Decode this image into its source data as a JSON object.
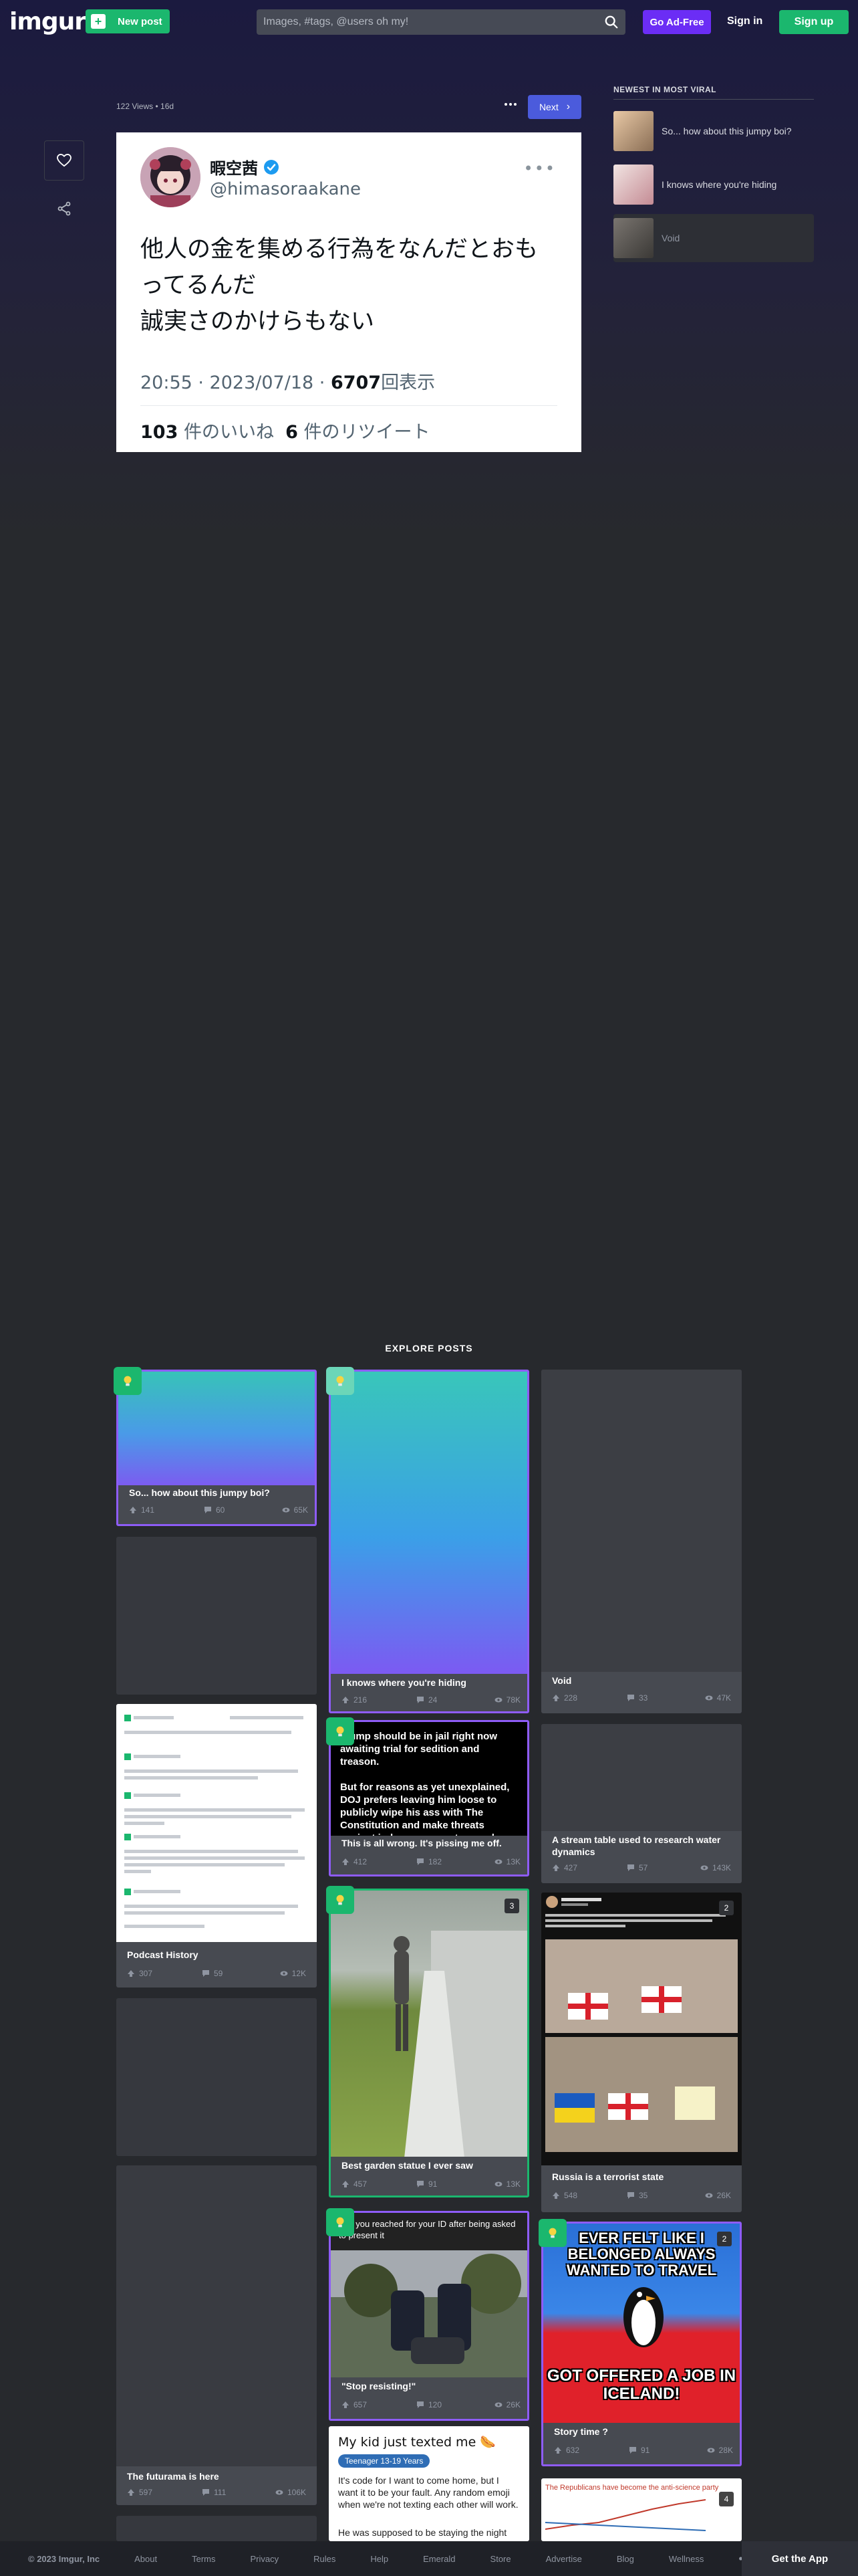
{
  "header": {
    "logo": "imgur",
    "new_post_label": "New post",
    "search_placeholder": "Images, #tags, @users oh my!",
    "adfree_label": "Go Ad-Free",
    "signin_label": "Sign in",
    "signup_label": "Sign up"
  },
  "post": {
    "meta": "122 Views • 16d",
    "next_label": "Next",
    "tweet": {
      "name": "暇空茜",
      "handle": "@himasoraakane",
      "lines": [
        "他人の金を集める行為をなんだとおも",
        "ってるんだ",
        "誠実さのかけらもない"
      ],
      "time": "20:55 · 2023/07/18 · ",
      "views_count": "6707",
      "views_label": "回表示",
      "likes_count": "103",
      "likes_label": "件のいいね",
      "retweets_count": "6",
      "retweets_label": "件のリツイート"
    }
  },
  "sidebar": {
    "title": "NEWEST IN MOST VIRAL",
    "items": [
      {
        "title": "So... how about this jumpy boi?"
      },
      {
        "title": "I knows where you're hiding"
      },
      {
        "title": "Void"
      }
    ]
  },
  "explore": {
    "title": "EXPLORE POSTS",
    "cards": [
      {
        "title": "So... how about this jumpy boi?",
        "up": "141",
        "comments": "60",
        "views": "65K"
      },
      {
        "title": "I knows where you're hiding",
        "up": "216",
        "comments": "24",
        "views": "78K"
      },
      {
        "title": "Void",
        "up": "228",
        "comments": "33",
        "views": "47K"
      },
      {
        "title": "Podcast History",
        "up": "307",
        "comments": "59",
        "views": "12K"
      },
      {
        "title": "This is all wrong.  It's pissing me off.",
        "up": "412",
        "comments": "182",
        "views": "13K",
        "overlay": "Trump should be in jail right now awaiting trial for sedition and treason.\n\nBut for reasons as yet unexplained, DOJ prefers leaving him loose to publicly wipe his ass with The Constitution and make threats against judges, prosecutors and their families on a daily basis."
      },
      {
        "title": "A stream table used to research water dynamics",
        "up": "427",
        "comments": "57",
        "views": "143K"
      },
      {
        "title": "Best garden statue I ever saw",
        "up": "457",
        "comments": "91",
        "views": "13K",
        "count": "3"
      },
      {
        "title": "Russia is a terrorist state",
        "up": "548",
        "comments": "35",
        "views": "26K",
        "count": "2"
      },
      {
        "title": "\"Stop resisting!\"",
        "up": "657",
        "comments": "120",
        "views": "26K",
        "overlay": "Me: you reached for your ID after being asked to present it"
      },
      {
        "title": "Story time ?",
        "up": "632",
        "comments": "91",
        "views": "28K",
        "count": "2",
        "meme_top": "EVER FELT LIKE I BELONGED ALWAYS WANTED TO TRAVEL",
        "meme_bottom": "GOT OFFERED A JOB IN ICELAND!"
      },
      {
        "title": "The futurama is here",
        "up": "597",
        "comments": "111",
        "views": "106K"
      },
      {
        "title": "My kid just texted me 🌭",
        "tag": "Teenager 13-19 Years",
        "text1": "It's code for I want to come home, but I want it to be your fault. Any random emoji when we're not texting each other will work.",
        "text2": "He was supposed to be staying the night"
      },
      {
        "title": "The Republicans have become the anti-science party",
        "count": "4"
      }
    ]
  },
  "footer": {
    "copyright": "© 2023 Imgur, Inc",
    "links": [
      "About",
      "Terms",
      "Privacy",
      "Rules",
      "Help",
      "Emerald",
      "Store",
      "Advertise",
      "Blog",
      "Wellness"
    ],
    "get_app": "Get the App"
  },
  "colors": {
    "green": "#1bb76e",
    "purple": "#6b2df5",
    "blue": "#4b5bdc",
    "promoted_border": "#8e5cf7"
  }
}
